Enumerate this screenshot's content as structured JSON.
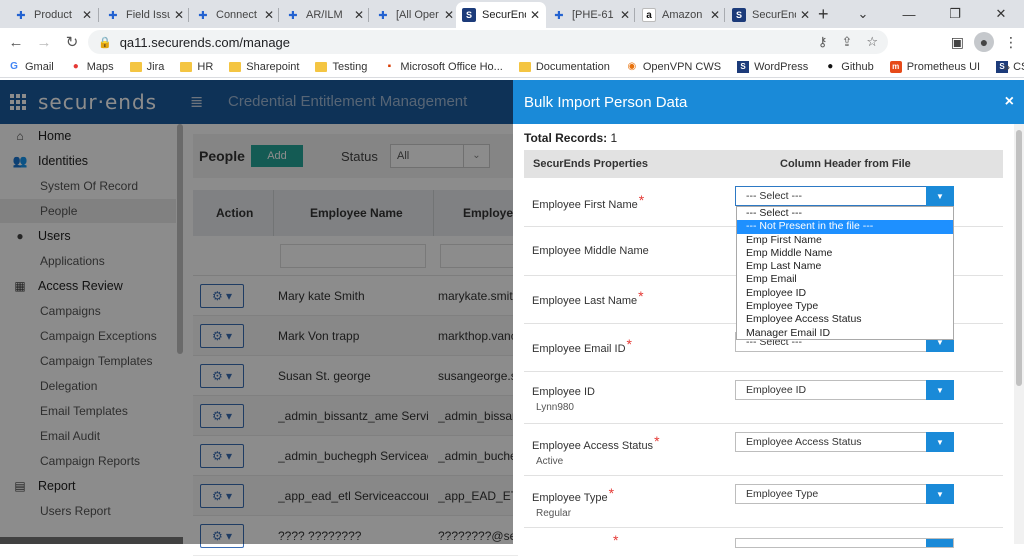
{
  "browser": {
    "tabs": [
      {
        "title": "Product",
        "icon": "jira-icon",
        "active": false
      },
      {
        "title": "Field Issu",
        "icon": "jira-icon",
        "active": false
      },
      {
        "title": "Connect",
        "icon": "jira-icon",
        "active": false
      },
      {
        "title": "AR/ILM",
        "icon": "jira-icon",
        "active": false
      },
      {
        "title": "[All Oper",
        "icon": "jira-icon",
        "active": false
      },
      {
        "title": "SecurEnds",
        "icon": "securends-icon",
        "active": true
      },
      {
        "title": "[PHE-61",
        "icon": "jira-icon",
        "active": false
      },
      {
        "title": "Amazon",
        "icon": "amazon-icon",
        "active": false
      },
      {
        "title": "SecurEnd",
        "icon": "securends-icon",
        "active": false
      }
    ],
    "url": "qa11.securends.com/manage",
    "bookmarks": [
      {
        "label": "Gmail",
        "icon": "google-icon"
      },
      {
        "label": "Maps",
        "icon": "maps-pin-icon"
      },
      {
        "label": "Jira",
        "icon": "folder-icon"
      },
      {
        "label": "HR",
        "icon": "folder-icon"
      },
      {
        "label": "Sharepoint",
        "icon": "folder-icon"
      },
      {
        "label": "Testing",
        "icon": "folder-icon"
      },
      {
        "label": "Microsoft Office Ho...",
        "icon": "microsoft-office-icon"
      },
      {
        "label": "Documentation",
        "icon": "folder-icon"
      },
      {
        "label": "OpenVPN CWS",
        "icon": "openvpn-icon"
      },
      {
        "label": "WordPress",
        "icon": "securends-icon"
      },
      {
        "label": "Github",
        "icon": "github-icon"
      },
      {
        "label": "Prometheus UI",
        "icon": "prometheus-icon"
      },
      {
        "label": "CSV Utility",
        "icon": "securends-icon"
      }
    ],
    "more": "»"
  },
  "app": {
    "logo": "secur·ends",
    "title": "Credential Entitlement Management"
  },
  "sidebar": {
    "items": [
      {
        "label": "Home",
        "icon": "home-icon",
        "type": "head"
      },
      {
        "label": "Identities",
        "icon": "users-group-icon",
        "type": "head"
      },
      {
        "label": "System Of Record",
        "type": "sub"
      },
      {
        "label": "People",
        "type": "sub",
        "selected": true
      },
      {
        "label": "Users",
        "icon": "user-icon",
        "type": "head"
      },
      {
        "label": "Applications",
        "type": "sub"
      },
      {
        "label": "Access Review",
        "icon": "grid-icon",
        "type": "head"
      },
      {
        "label": "Campaigns",
        "type": "sub"
      },
      {
        "label": "Campaign Exceptions",
        "type": "sub"
      },
      {
        "label": "Campaign Templates",
        "type": "sub"
      },
      {
        "label": "Delegation",
        "type": "sub"
      },
      {
        "label": "Email Templates",
        "type": "sub"
      },
      {
        "label": "Email Audit",
        "type": "sub"
      },
      {
        "label": "Campaign Reports",
        "type": "sub"
      },
      {
        "label": "Report",
        "icon": "report-icon",
        "type": "head"
      },
      {
        "label": "Users Report",
        "type": "sub"
      }
    ]
  },
  "people": {
    "title": "People",
    "add_label": "Add",
    "status_label": "Status",
    "status_value": "All",
    "columns": [
      "Action",
      "Employee Name",
      "Employe"
    ],
    "rows": [
      {
        "name": "Mary kate Smith",
        "email": "marykate.smit"
      },
      {
        "name": "Mark Von trapp",
        "email": "markthop.vanc"
      },
      {
        "name": "Susan St. george",
        "email": "susangeorge.s"
      },
      {
        "name": "_admin_bissantz_ame Servicea",
        "email": "_admin_bissan"
      },
      {
        "name": "_admin_buchegph Serviceacco",
        "email": "_admin_buche"
      },
      {
        "name": "_app_ead_etl Serviceaccount",
        "email": "_app_EAD_ETL"
      },
      {
        "name": "???? ????????",
        "email": "????????@secur"
      }
    ]
  },
  "modal": {
    "title": "Bulk Import Person Data",
    "total_label": "Total Records:",
    "total_value": "1",
    "col_properties": "SecurEnds Properties",
    "col_header": "Column Header from File",
    "fields": [
      {
        "label": "Employee First Name",
        "required": true,
        "value": "--- Select ---",
        "sub": ""
      },
      {
        "label": "Employee Middle Name",
        "required": false,
        "value": "",
        "sub": ""
      },
      {
        "label": "Employee Last Name",
        "required": true,
        "value": "",
        "sub": ""
      },
      {
        "label": "Employee Email ID",
        "required": true,
        "value": "--- Select ---",
        "sub": ""
      },
      {
        "label": "Employee ID",
        "required": false,
        "value": "Employee ID",
        "sub": "Lynn980"
      },
      {
        "label": "Employee Access Status",
        "required": true,
        "value": "Employee Access Status",
        "sub": "Active"
      },
      {
        "label": "Employee Type",
        "required": true,
        "value": "Employee Type",
        "sub": "Regular"
      }
    ],
    "dropdown_options": [
      "--- Select ---",
      "--- Not Present in the file ---",
      "Emp First Name",
      "Emp Middle Name",
      "Emp Last Name",
      "Emp Email",
      "Employee ID",
      "Employee Type",
      "Employee Access Status",
      "Manager Email ID"
    ],
    "dropdown_highlighted": "--- Not Present in the file ---",
    "required_mark": "*",
    "close": "×"
  },
  "colors": {
    "app_header": "#1b5c9e",
    "modal_header": "#1a8ad8",
    "add_button": "#26a69a",
    "required": "#e53935",
    "highlight": "#1e90ff"
  }
}
